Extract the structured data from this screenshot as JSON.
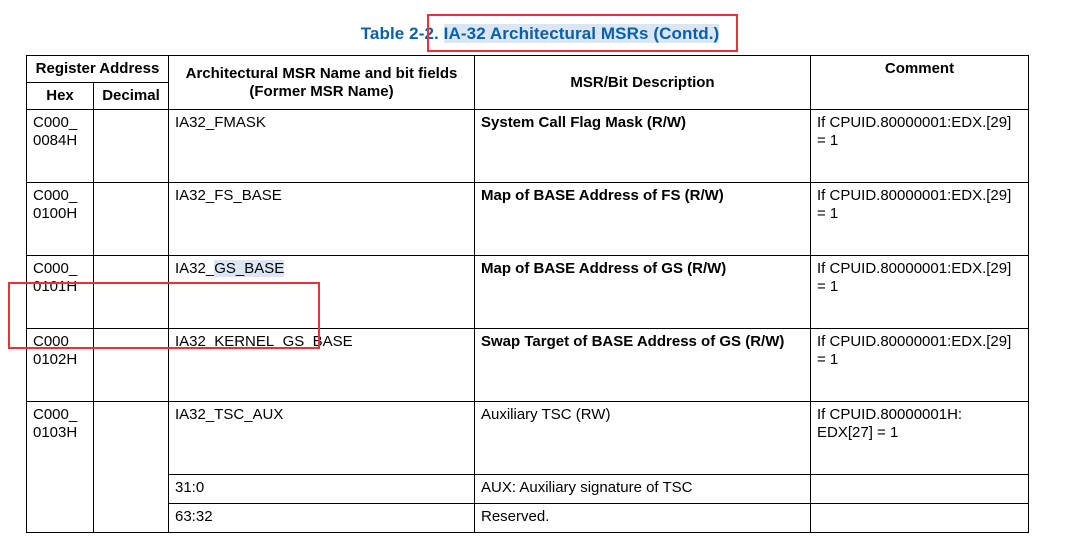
{
  "caption": {
    "number": "Table 2-2.",
    "title": "IA-32 Architectural MSRs (Contd.)"
  },
  "headers": {
    "register_address": "Register Address",
    "msr_name": "Architectural MSR Name and bit fields (Former MSR Name)",
    "description": "MSR/Bit Description",
    "comment": "Comment",
    "hex": "Hex",
    "decimal": "Decimal"
  },
  "rows": [
    {
      "hex": "C000_ 0084H",
      "decimal": "",
      "name": "IA32_FMASK",
      "description": "System Call Flag Mask (R/W)",
      "comment": "If CPUID.80000001:EDX.[29] = 1"
    },
    {
      "hex": "C000_ 0100H",
      "decimal": "",
      "name": "IA32_FS_BASE",
      "description": "Map of BASE Address of FS (R/W)",
      "comment": "If CPUID.80000001:EDX.[29] = 1"
    },
    {
      "hex": "C000_ 0101H",
      "decimal": "",
      "name_prefix": "IA32_",
      "name_selected": "GS_BASE",
      "description": "Map of BASE Address of GS (R/W)",
      "comment": "If CPUID.80000001:EDX.[29] = 1"
    },
    {
      "hex": "C000_ 0102H",
      "decimal": "",
      "name": "IA32_KERNEL_GS_BASE",
      "description": "Swap Target of BASE Address of GS (R/W)",
      "comment": "If CPUID.80000001:EDX.[29] = 1"
    },
    {
      "hex": "C000_ 0103H",
      "decimal": "",
      "name": "IA32_TSC_AUX",
      "description": "Auxiliary TSC (RW)",
      "comment": "If CPUID.80000001H: EDX[27] = 1"
    }
  ],
  "subrows": [
    {
      "bits": "31:0",
      "description": "AUX: Auxiliary signature of TSC",
      "comment": ""
    },
    {
      "bits": "63:32",
      "description": "Reserved.",
      "comment": ""
    }
  ],
  "colors": {
    "caption": "#0860a8",
    "highlight_box": "#e5333b",
    "selection": "#dbe6f4"
  }
}
